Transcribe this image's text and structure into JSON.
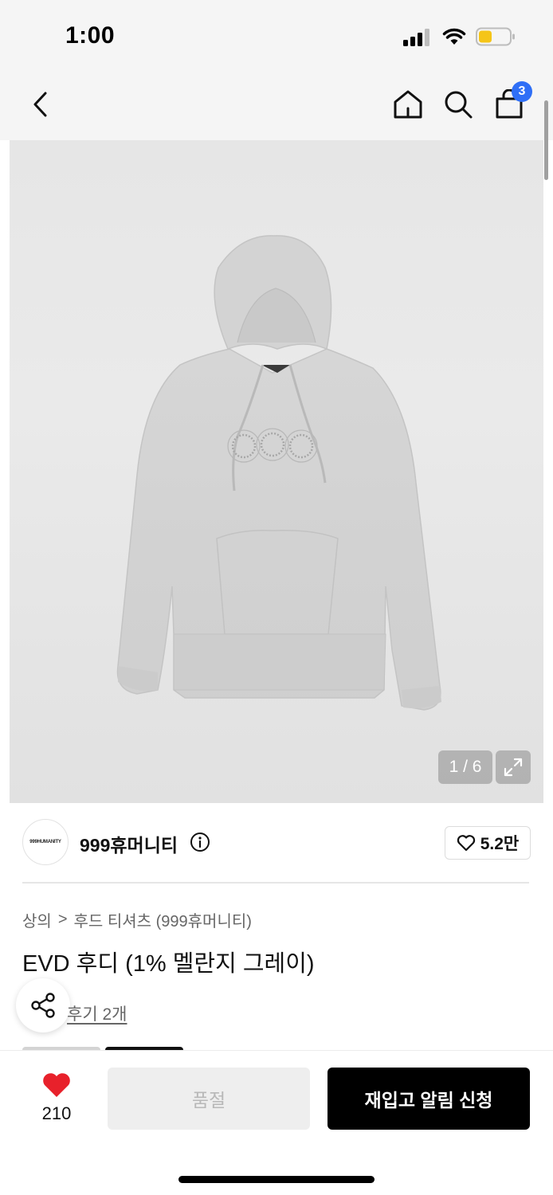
{
  "status_bar": {
    "time": "1:00"
  },
  "nav": {
    "cart_count": "3"
  },
  "gallery": {
    "counter": "1 / 6"
  },
  "brand": {
    "logo_text": "999HUMANITY",
    "name": "999휴머니티",
    "likes": "5.2만"
  },
  "breadcrumb": {
    "category": "상의",
    "separator": ">",
    "subcategory": "후드 티셔츠 (999휴머니티)"
  },
  "product": {
    "title": "EVD 후디 (1% 멜란지 그레이)",
    "review_text": "후기 2개"
  },
  "bottom_bar": {
    "wish_count": "210",
    "soldout_label": "품절",
    "restock_label": "재입고 알림 신청"
  },
  "colors": {
    "accent_badge": "#2f6ff6",
    "heart": "#e8212b",
    "primary_button": "#000000",
    "disabled_button": "#eeeeee"
  }
}
